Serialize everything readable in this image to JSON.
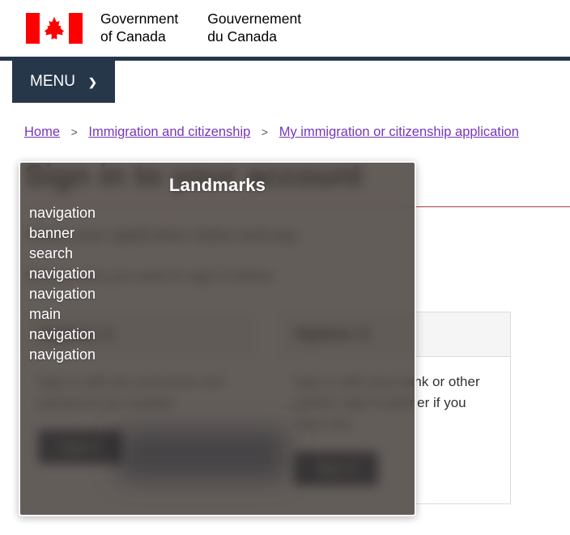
{
  "header": {
    "flag_alt": "canada-flag",
    "wordmark_en_line1": "Government",
    "wordmark_en_line2": "of Canada",
    "wordmark_fr_line1": "Gouvernement",
    "wordmark_fr_line2": "du Canada",
    "menu_label": "MENU",
    "menu_chevron": "❯"
  },
  "breadcrumb": {
    "items": [
      {
        "label": "Home"
      },
      {
        "label": "Immigration and citizenship"
      },
      {
        "label": "My immigration or citizenship application"
      }
    ],
    "separator": ">"
  },
  "main": {
    "page_title": "Sign in to your account",
    "lede": "Check your application status and pay",
    "sub_note": "Choose how you want to sign in below.",
    "panels": [
      {
        "heading": "Option 1",
        "body": "Sign in with the username and password you created.",
        "button_label": "Sign in"
      },
      {
        "heading": "Option 2",
        "body": "Sign in with your bank or other partner sign-in partner if you have one.",
        "button_label": "Sign in"
      }
    ]
  },
  "landmarks_overlay": {
    "title": "Landmarks",
    "items": [
      "navigation",
      "banner",
      "search",
      "navigation",
      "navigation",
      "main",
      "navigation",
      "navigation"
    ]
  },
  "colors": {
    "gc_navy": "#26374A",
    "flag_red": "#FF0000",
    "title_rule_red": "#AF3C43",
    "visited_link_purple": "#7834BC",
    "overlay_gray": "#5C5754",
    "panel_head_gray": "#F5F5F5"
  }
}
